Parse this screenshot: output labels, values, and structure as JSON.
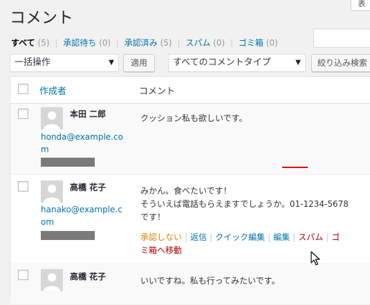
{
  "header": {
    "title": "コメント",
    "screen_options": "表"
  },
  "filters": {
    "current": {
      "label": "すべて",
      "count": "(5)"
    },
    "items": [
      {
        "label": "承認待ち",
        "count": "(0)"
      },
      {
        "label": "承認済み",
        "count": "(5)"
      },
      {
        "label": "スパム",
        "count": "(0)"
      },
      {
        "label": "ゴミ箱",
        "count": "(0)"
      }
    ],
    "separator": "|"
  },
  "toolbar": {
    "bulk_action": "一括操作",
    "apply": "適用",
    "type_filter": "すべてのコメントタイプ",
    "filter_button": "絞り込み検索"
  },
  "table": {
    "col_author": "作成者",
    "col_comment": "コメント",
    "rows": [
      {
        "name": "本田 二郎",
        "email": "honda@example.com",
        "text": [
          "クッション私も欲しいです。"
        ]
      },
      {
        "name": "高橋 花子",
        "email": "hanako@example.com",
        "text": [
          "みかん。食べたいです！",
          "そういえば電話もらえますでしょうか。01-1234-5678",
          "です！"
        ]
      },
      {
        "name": "高橋 花子",
        "email": "",
        "text": [
          "いいですね。私も行ってみたいです。"
        ]
      }
    ]
  },
  "row_actions": {
    "unapprove": "承認しない",
    "reply": "返信",
    "quick_edit": "クイック編集",
    "edit": "編集",
    "spam": "スパム",
    "trash_line1": "ゴ",
    "trash_line2": "ミ箱へ移動"
  },
  "colors": {
    "link": "#0073aa",
    "warning": "#d98500",
    "danger": "#aa0000",
    "highlight": "#dd0000"
  }
}
